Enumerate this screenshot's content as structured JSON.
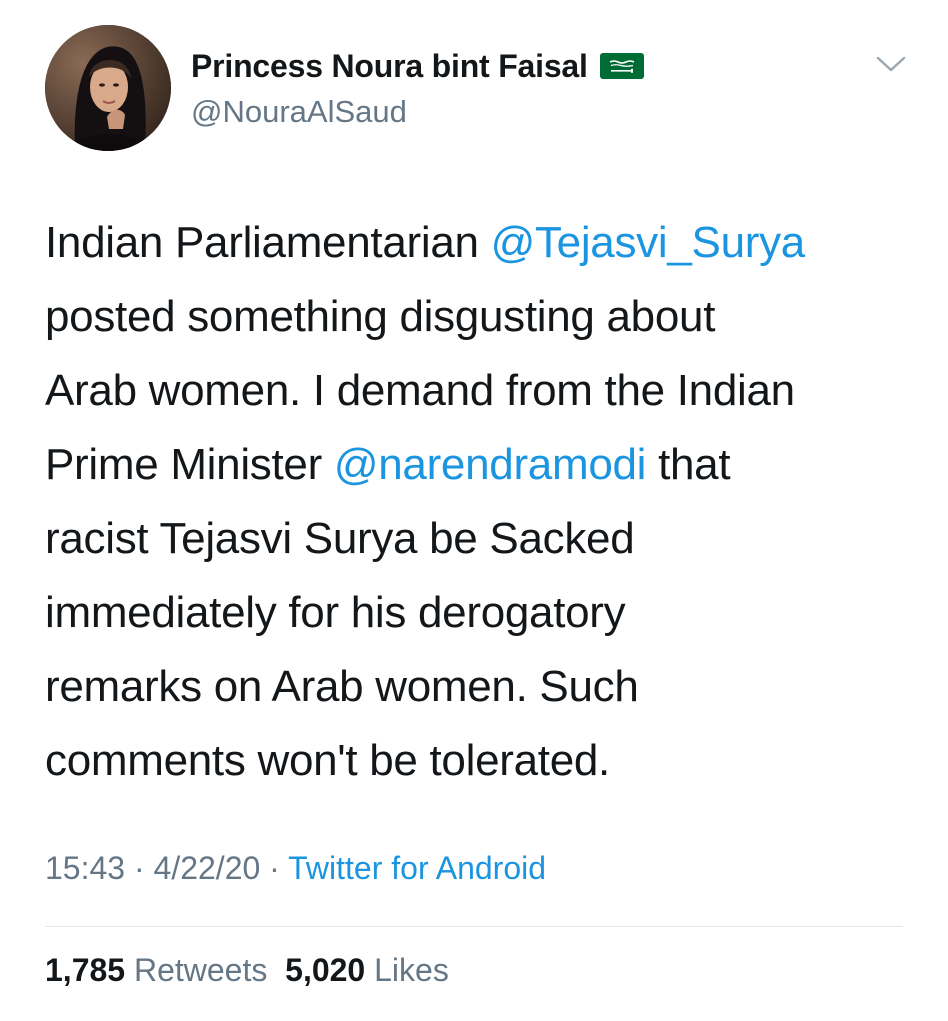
{
  "author": {
    "display_name": "Princess Noura bint Faisal",
    "handle": "@NouraAlSaud",
    "flag_icon": "saudi-arabia-flag-icon"
  },
  "menu": {
    "icon": "chevron-down-icon"
  },
  "tweet": {
    "lines": [
      [
        {
          "t": "Indian Parliamentarian ",
          "m": false
        },
        {
          "t": "@Tejasvi_Surya",
          "m": true
        }
      ],
      [
        {
          "t": "posted something disgusting about",
          "m": false
        }
      ],
      [
        {
          "t": "Arab women. I demand from the Indian",
          "m": false
        }
      ],
      [
        {
          "t": "Prime Minister ",
          "m": false
        },
        {
          "t": "@narendramodi",
          "m": true
        },
        {
          "t": " that",
          "m": false
        }
      ],
      [
        {
          "t": "racist Tejasvi Surya be Sacked",
          "m": false
        }
      ],
      [
        {
          "t": "immediately for his derogatory",
          "m": false
        }
      ],
      [
        {
          "t": "remarks on Arab women. Such",
          "m": false
        }
      ],
      [
        {
          "t": "comments won't be tolerated.",
          "m": false
        }
      ]
    ]
  },
  "meta": {
    "time": "15:43",
    "separator": " · ",
    "date": "4/22/20",
    "source": "Twitter for Android"
  },
  "stats": {
    "retweets_count": "1,785",
    "retweets_label": "Retweets",
    "likes_count": "5,020",
    "likes_label": "Likes"
  },
  "colors": {
    "text": "#14171a",
    "secondary": "#657786",
    "link": "#1b95e0",
    "divider": "#e1e8ed",
    "flag_green": "#006c35"
  }
}
